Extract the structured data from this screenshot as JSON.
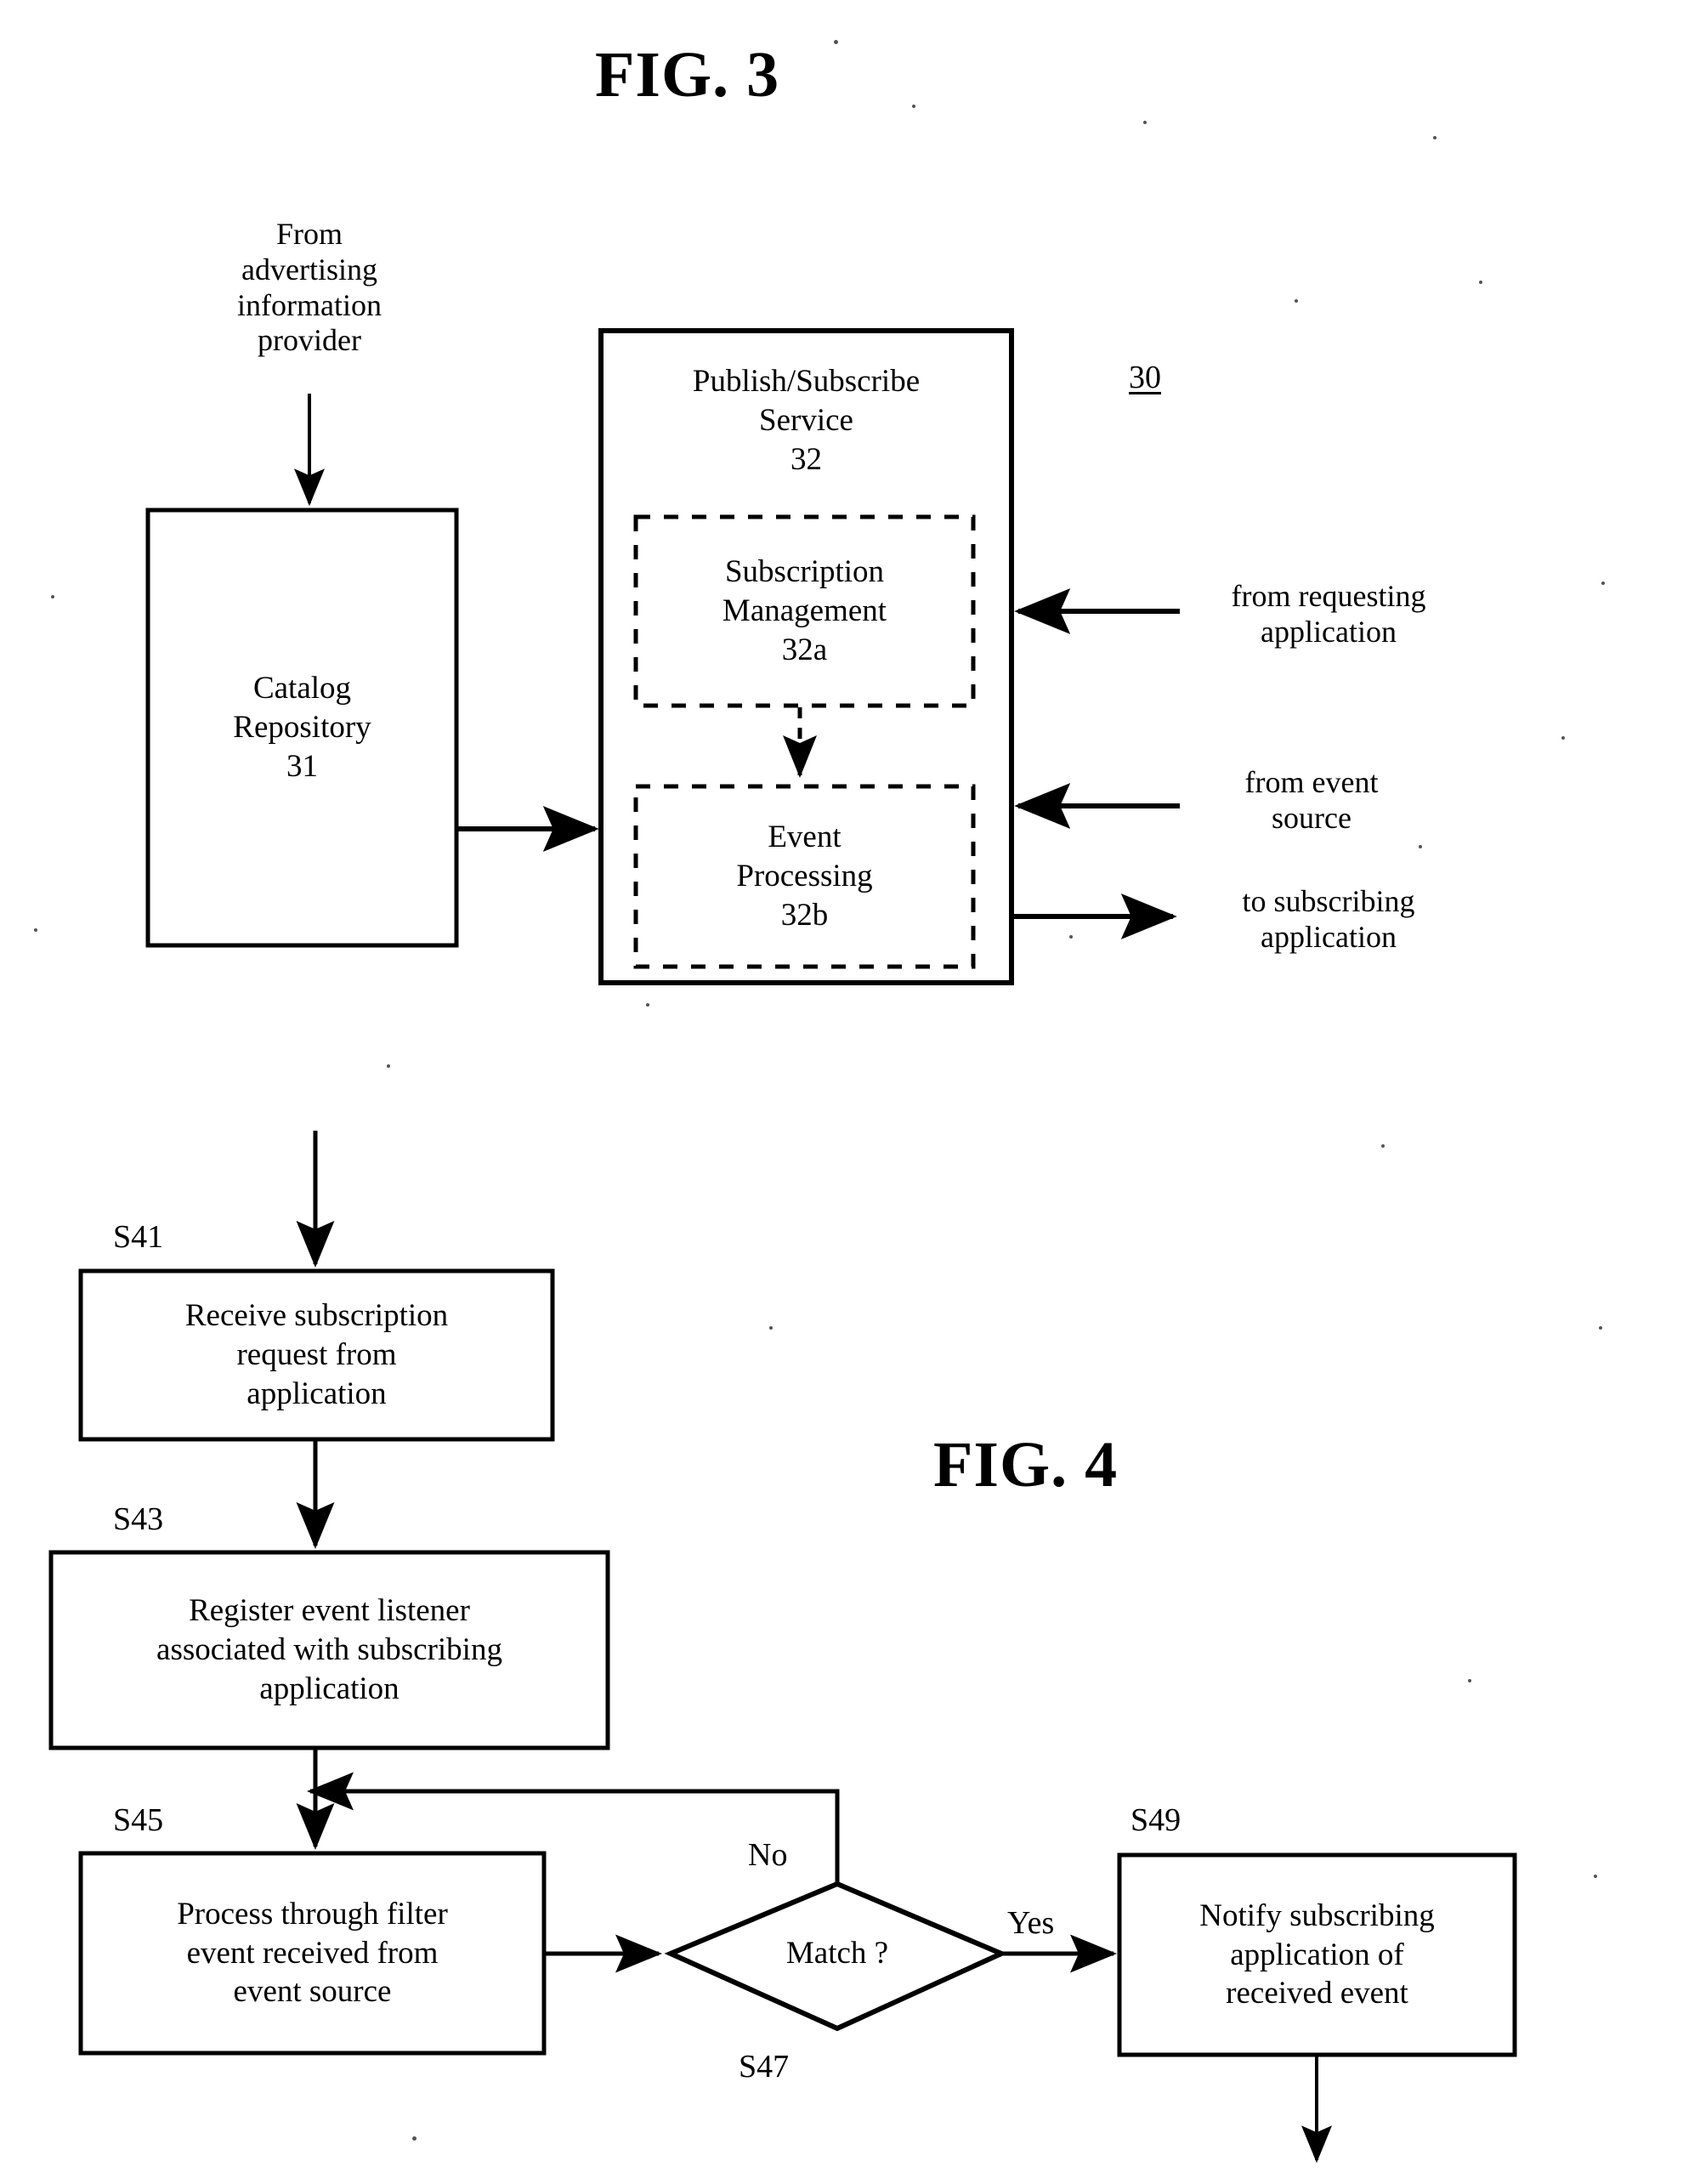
{
  "document": {
    "kind": "patent-drawing-sheet",
    "figures": [
      {
        "id": "fig3",
        "title": "FIG. 3",
        "reference_numeral": "30"
      },
      {
        "id": "fig4",
        "title": "FIG. 4"
      }
    ]
  },
  "fig3": {
    "title": "FIG. 3",
    "system_ref": "30",
    "source_label": "From\nadvertising\ninformation\nprovider",
    "catalog_box": {
      "label": "Catalog\nRepository\n31",
      "name": "Catalog Repository",
      "ref": "31"
    },
    "service_box": {
      "label": "Publish/Subscribe\nService\n32",
      "name": "Publish/Subscribe Service",
      "ref": "32"
    },
    "subscription_box": {
      "label": "Subscription\nManagement\n32a",
      "name": "Subscription Management",
      "ref": "32a"
    },
    "event_box": {
      "label": "Event\nProcessing\n32b",
      "name": "Event Processing",
      "ref": "32b"
    },
    "annotations": {
      "requesting": "from requesting\napplication",
      "event_source": "from event\nsource",
      "subscribing": "to subscribing\napplication"
    }
  },
  "fig4": {
    "title": "FIG. 4",
    "steps": [
      {
        "tag": "S41",
        "label": "Receive subscription\nrequest from\napplication",
        "shape": "process"
      },
      {
        "tag": "S43",
        "label": "Register event listener\nassociated with subscribing\napplication",
        "shape": "process"
      },
      {
        "tag": "S45",
        "label": "Process through filter\nevent received from\nevent source",
        "shape": "process"
      },
      {
        "tag": "S47",
        "label": "Match ?",
        "shape": "decision"
      },
      {
        "tag": "S49",
        "label": "Notify subscribing\napplication of\nreceived event",
        "shape": "process"
      }
    ],
    "branch_labels": {
      "no": "No",
      "yes": "Yes"
    }
  },
  "colors": {
    "ink": "#000000",
    "paper": "#ffffff"
  }
}
